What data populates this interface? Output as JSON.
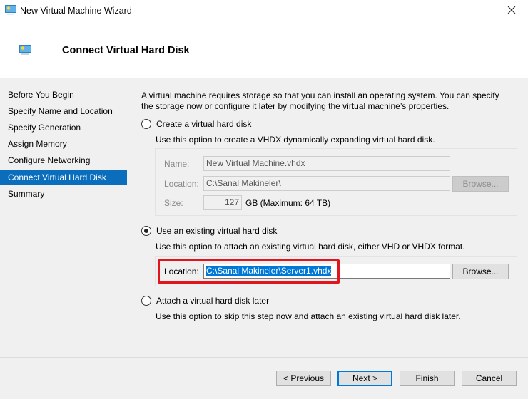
{
  "window": {
    "title": "New Virtual Machine Wizard",
    "app_icon": "virtual-machine-icon",
    "close_icon": "close-icon"
  },
  "header": {
    "title": "Connect Virtual Hard Disk",
    "icon": "virtual-machine-icon"
  },
  "sidebar": {
    "active_index": 5,
    "items": [
      {
        "label": "Before You Begin"
      },
      {
        "label": "Specify Name and Location"
      },
      {
        "label": "Specify Generation"
      },
      {
        "label": "Assign Memory"
      },
      {
        "label": "Configure Networking"
      },
      {
        "label": "Connect Virtual Hard Disk"
      },
      {
        "label": "Summary"
      }
    ]
  },
  "content": {
    "intro": "A virtual machine requires storage so that you can install an operating system. You can specify the storage now or configure it later by modifying the virtual machine’s properties.",
    "selected_option": "existing",
    "options": {
      "create": {
        "label": "Create a virtual hard disk",
        "description": "Use this option to create a VHDX dynamically expanding virtual hard disk.",
        "checked": false,
        "name_label": "Name:",
        "name_value": "New Virtual Machine.vhdx",
        "location_label": "Location:",
        "location_value": "C:\\Sanal Makineler\\",
        "browse_label": "Browse...",
        "size_label": "Size:",
        "size_value": "127",
        "size_unit": "GB (Maximum: 64 TB)"
      },
      "existing": {
        "label": "Use an existing virtual hard disk",
        "description": "Use this option to attach an existing virtual hard disk, either VHD or VHDX format.",
        "checked": true,
        "location_label": "Location:",
        "location_value": "C:\\Sanal Makineler\\Server1.vhdx",
        "browse_label": "Browse..."
      },
      "later": {
        "label": "Attach a virtual hard disk later",
        "description": "Use this option to skip this step now and attach an existing virtual hard disk later.",
        "checked": false
      }
    }
  },
  "footer": {
    "previous_label": "< Previous",
    "next_label": "Next >",
    "finish_label": "Finish",
    "cancel_label": "Cancel"
  },
  "colors": {
    "accent": "#0078d7",
    "nav_selected": "#0a6ebd",
    "highlight_box": "#e2141c"
  }
}
